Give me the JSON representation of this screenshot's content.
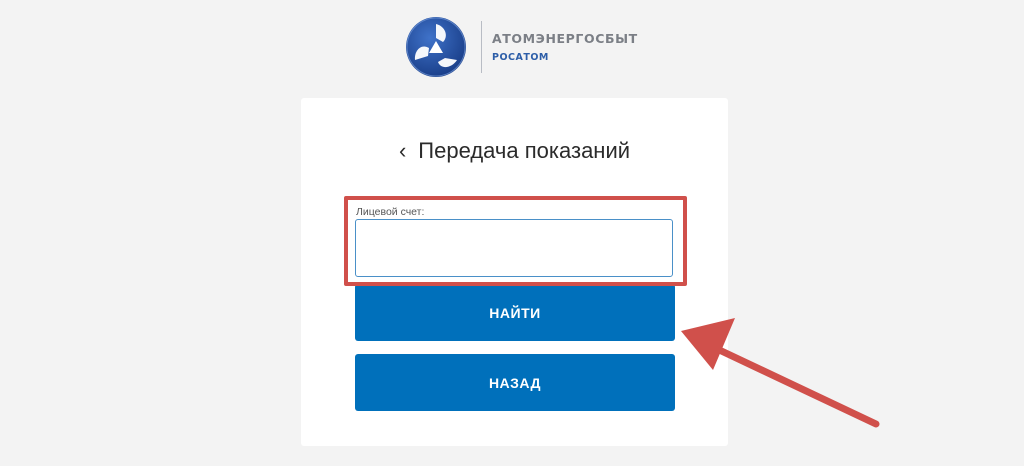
{
  "header": {
    "company_name": "АТОМЭНЕРГОСБЫТ",
    "company_sub": "РОСАТОМ",
    "logo_icon": "rosatom-logo-icon"
  },
  "card": {
    "back_icon": "chevron-left-icon",
    "back_glyph": "‹",
    "title": "Передача показаний",
    "account_field": {
      "label": "Лицевой счет:",
      "value": "",
      "placeholder": ""
    },
    "search_button": "НАЙТИ",
    "back_button": "НАЗАД"
  },
  "colors": {
    "page_bg": "#f3f3f3",
    "card_bg": "#ffffff",
    "button_blue": "#0070bb",
    "annotation_red": "#d0504b",
    "input_border": "#4a90c8"
  }
}
